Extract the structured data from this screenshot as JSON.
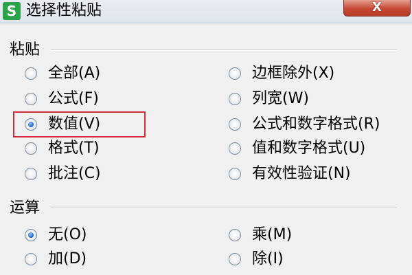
{
  "window": {
    "app_icon_text": "S",
    "title": "选择性粘贴",
    "close_label": "X"
  },
  "paste_section": {
    "label": "粘贴",
    "options": [
      {
        "label": "全部(A)",
        "checked": false
      },
      {
        "label": "公式(F)",
        "checked": false
      },
      {
        "label": "数值(V)",
        "checked": true
      },
      {
        "label": "格式(T)",
        "checked": false
      },
      {
        "label": "批注(C)",
        "checked": false
      },
      {
        "label": "边框除外(X)",
        "checked": false
      },
      {
        "label": "列宽(W)",
        "checked": false
      },
      {
        "label": "公式和数字格式(R)",
        "checked": false
      },
      {
        "label": "值和数字格式(U)",
        "checked": false
      },
      {
        "label": "有效性验证(N)",
        "checked": false
      }
    ]
  },
  "operation_section": {
    "label": "运算",
    "options": [
      {
        "label": "无(O)",
        "checked": true
      },
      {
        "label": "加(D)",
        "checked": false
      },
      {
        "label": "乘(M)",
        "checked": false
      },
      {
        "label": "除(I)",
        "checked": false
      }
    ]
  },
  "colors": {
    "highlight": "#d02f3a",
    "radio_selected": "#1d5fb5",
    "app_icon": "#2aa34a"
  }
}
